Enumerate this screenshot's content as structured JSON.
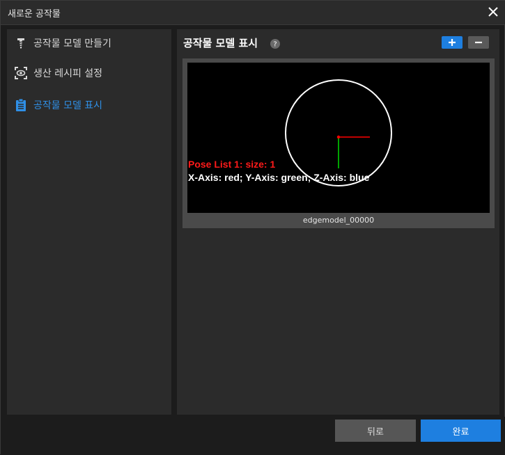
{
  "window": {
    "title": "새로운 공작물",
    "close_icon": "close-icon"
  },
  "sidebar": {
    "items": [
      {
        "label": "공작물 모델 만들기",
        "icon": "screw-icon",
        "active": false
      },
      {
        "label": "생산 레시피 설정",
        "icon": "eye-scan-icon",
        "active": false
      },
      {
        "label": "공작물 모델 표시",
        "icon": "clipboard-icon",
        "active": true
      }
    ]
  },
  "main": {
    "title": "공작물 모델 표시",
    "help_icon": "question-icon",
    "add_icon": "plus-icon",
    "remove_icon": "minus-icon",
    "viewer": {
      "pose_line_1": "Pose List 1: size: 1",
      "pose_line_2": "X-Axis: red; Y-Axis: green; Z-Axis: blue"
    },
    "thumbnail_caption": "edgemodel_00000"
  },
  "footer": {
    "back_label": "뒤로",
    "done_label": "완료"
  },
  "colors": {
    "accent": "#1e7fe0",
    "active_text": "#2f8fe6",
    "x_axis": "#ff0000",
    "y_axis": "#00cc00"
  }
}
